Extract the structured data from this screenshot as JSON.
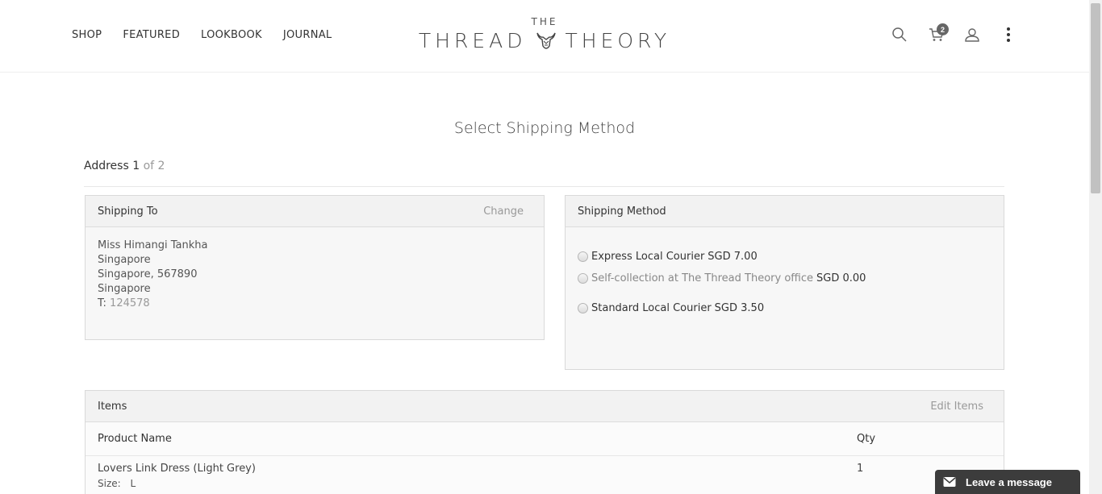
{
  "nav": {
    "items": [
      "SHOP",
      "FEATURED",
      "LOOKBOOK",
      "JOURNAL"
    ]
  },
  "logo": {
    "the": "THE",
    "left": "THREAD",
    "right": "THEORY"
  },
  "header_icons": {
    "search": "search-icon",
    "cart": "cart-icon",
    "account": "user-icon",
    "more": "more-vertical-icon",
    "cart_count": "2"
  },
  "page": {
    "title": "Select Shipping Method"
  },
  "address_count": {
    "current": "Address 1",
    "total": "of 2"
  },
  "shipping_to": {
    "title": "Shipping To",
    "change_label": "Change",
    "name": "Miss Himangi Tankha",
    "line1": "Singapore",
    "line2": "Singapore, 567890",
    "country": "Singapore",
    "phone_label": "T:",
    "phone": "124578"
  },
  "shipping_method": {
    "title": "Shipping Method",
    "options": [
      {
        "label": "Express Local Courier",
        "price": "SGD 7.00"
      },
      {
        "label": "Self-collection at The Thread Theory office",
        "price": "SGD 0.00"
      },
      {
        "label": "Standard Local Courier",
        "price": "SGD 3.50"
      }
    ]
  },
  "items": {
    "title": "Items",
    "edit_label": "Edit Items",
    "columns": {
      "name": "Product Name",
      "qty": "Qty"
    },
    "rows": [
      {
        "name": "Lovers Link Dress (Light Grey)",
        "size_label": "Size:",
        "size": "L",
        "qty": "1"
      }
    ]
  },
  "chat": {
    "label": "Leave a message"
  }
}
